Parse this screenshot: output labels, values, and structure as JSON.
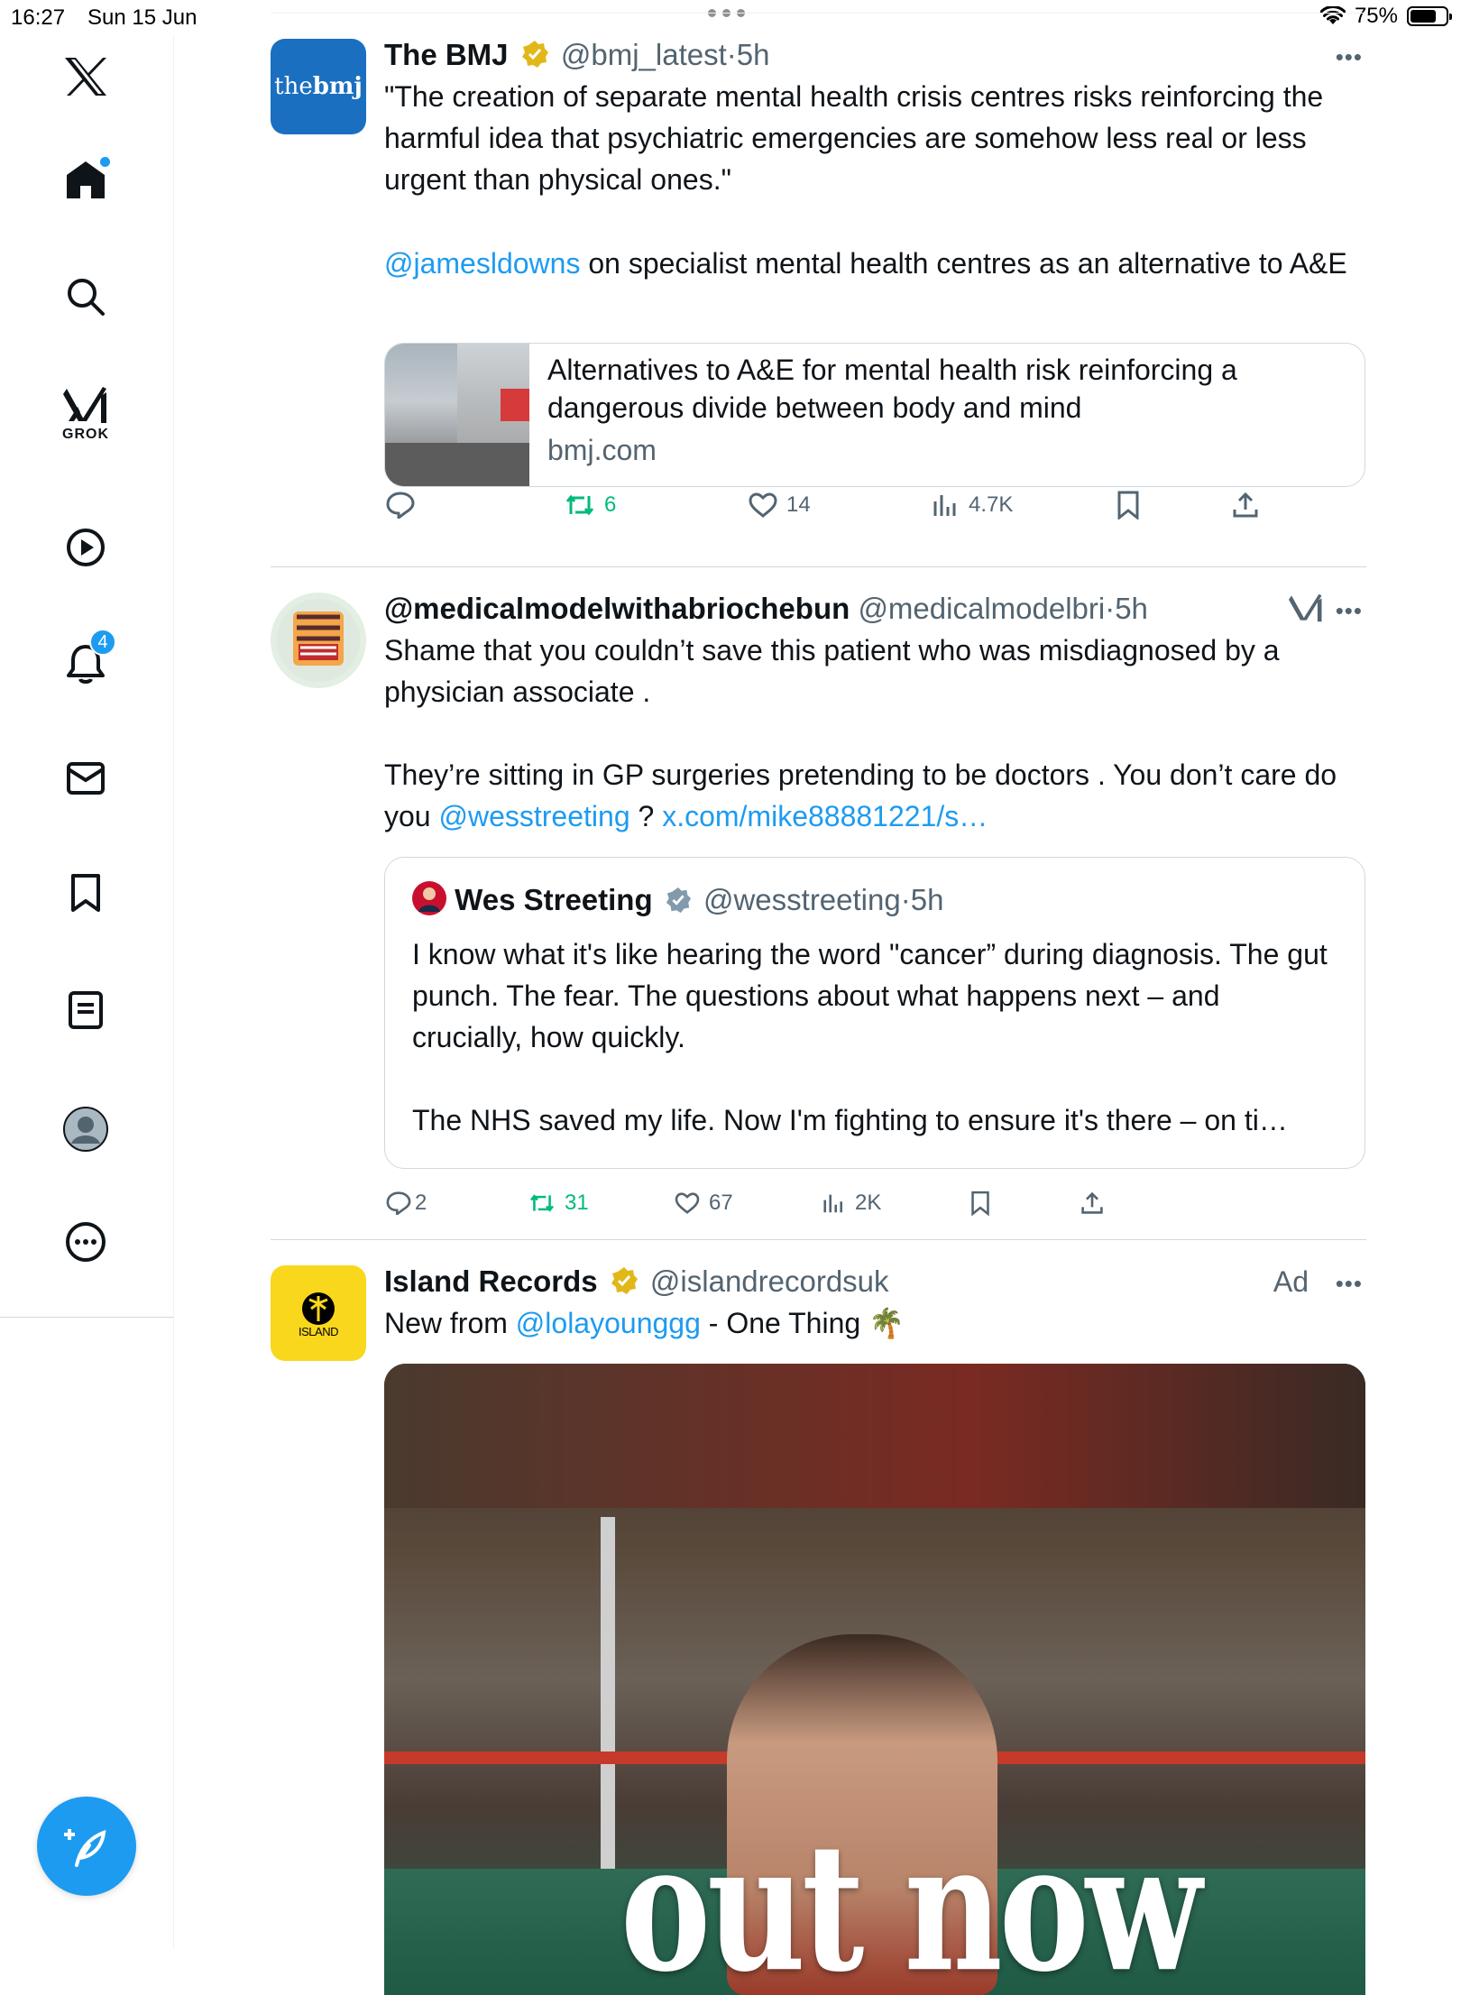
{
  "status": {
    "time": "16:27",
    "date": "Sun 15 Jun",
    "battery": "75%",
    "battery_level": 0.75
  },
  "sidebar": {
    "grok_label": "GROK",
    "notification_count": "4",
    "icons": [
      "x-logo-icon",
      "home-icon",
      "search-icon",
      "grok-icon",
      "video-icon",
      "bell-icon",
      "mail-icon",
      "bookmark-icon",
      "lists-icon",
      "profile-icon",
      "more-icon"
    ]
  },
  "tweets": [
    {
      "name": "The BMJ",
      "handle": "@bmj_latest",
      "sep": "·",
      "time": "5h",
      "avatar_text_a": "the",
      "avatar_text_b": "bmj",
      "text1": "\"The creation of separate mental health crisis centres risks reinforcing the harmful idea that psychiatric emergencies are somehow less real or less urgent than physical ones.\"",
      "mention": "@jamesldowns",
      "text2": " on specialist mental health centres as an alternative to A&E",
      "card_title": "Alternatives to A&E for mental health risk reinforcing a dangerous divide between body and mind",
      "card_domain": "bmj.com",
      "replies": "",
      "retweets": "6",
      "likes": "14",
      "views": "4.7K"
    },
    {
      "name": "@medicalmodelwithabriochebun",
      "handle": "@medicalmodelbri",
      "sep": "·",
      "time": "5h",
      "text1": "Shame that you couldn’t save this patient who was misdiagnosed by a physician associate .",
      "text2a": "They’re sitting in GP surgeries pretending to be doctors . You don’t care do you ",
      "mention": "@wesstreeting",
      "text2b": " ? ",
      "link": "x.com/mike88881221/s…",
      "quote": {
        "name": "Wes Streeting",
        "handle": "@wesstreeting",
        "sep": "·",
        "time": "5h",
        "text1": "I know what it's like hearing the word \"cancer” during diagnosis. The gut punch. The fear. The questions about what happens next – and crucially, how quickly.",
        "text2": "The NHS saved my life. Now I'm fighting to ensure it's there – on ti…"
      },
      "replies": "2",
      "retweets": "31",
      "likes": "67",
      "views": "2K"
    },
    {
      "name": "Island Records",
      "handle": "@islandrecordsuk",
      "ad_label": "Ad",
      "avatar_text": "ISLAND",
      "text_prefix": "New from ",
      "mention": "@lolayounggg",
      "text_suffix": " - One Thing 🌴",
      "media_text": "out now"
    }
  ],
  "colors": {
    "accent": "#1d9bf0",
    "retweet": "#00ba7c",
    "muted": "#536471",
    "bmj_blue": "#1b6fc0",
    "island_yellow": "#f9d71c"
  }
}
